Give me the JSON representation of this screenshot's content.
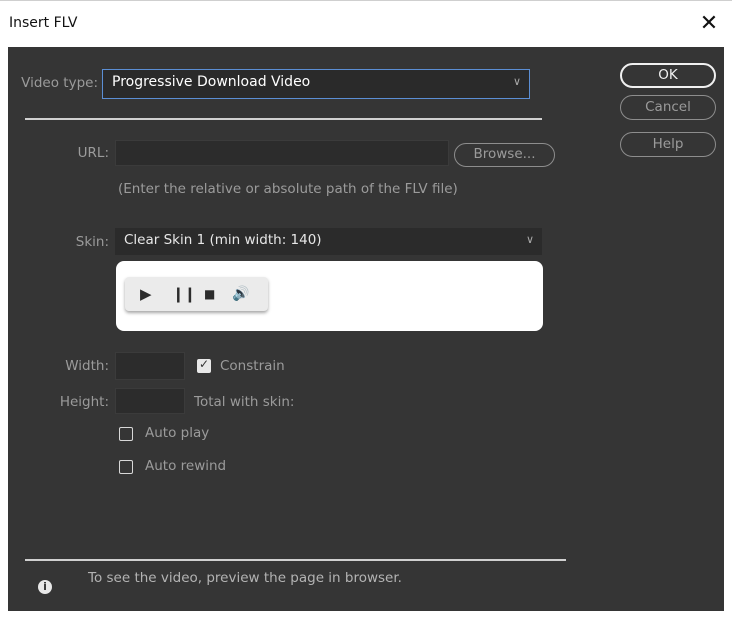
{
  "window": {
    "title": "Insert FLV",
    "close_glyph": "✕"
  },
  "video_type": {
    "label": "Video type:",
    "selected": "Progressive Download Video"
  },
  "buttons": {
    "ok": "OK",
    "cancel": "Cancel",
    "help": "Help",
    "browse": "Browse..."
  },
  "url": {
    "label": "URL:",
    "value": "",
    "hint": "(Enter the relative or absolute path of the FLV file)"
  },
  "skin": {
    "label": "Skin:",
    "selected": "Clear Skin 1 (min width: 140)",
    "controls": [
      "play-icon",
      "pause-icon",
      "stop-icon",
      "volume-icon"
    ]
  },
  "dimensions": {
    "width_label": "Width:",
    "width_value": "",
    "constrain_label": "Constrain",
    "constrain_checked": true,
    "height_label": "Height:",
    "height_value": "",
    "total_with_skin_label": "Total with skin:"
  },
  "options": {
    "auto_play_label": "Auto play",
    "auto_play_checked": false,
    "auto_rewind_label": "Auto rewind",
    "auto_rewind_checked": false
  },
  "footer": {
    "info_text": "To see the video, preview the page in browser."
  },
  "colors": {
    "dialog_bg": "#353535",
    "focus_border": "#5b8ed4",
    "field_bg": "#2c2c2c"
  }
}
